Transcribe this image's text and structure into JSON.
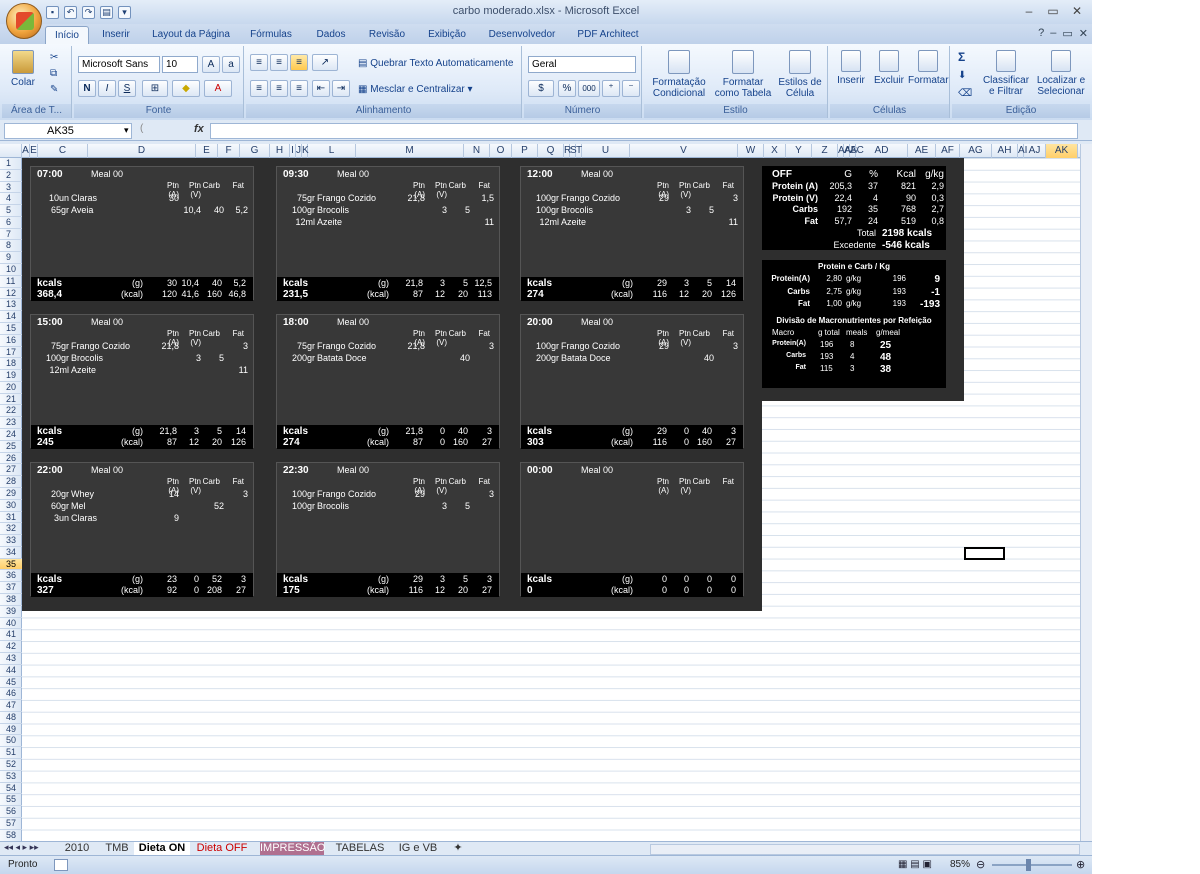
{
  "window": {
    "title": "carbo moderado.xlsx - Microsoft Excel"
  },
  "qat": [
    "save",
    "undo",
    "redo"
  ],
  "tabs": [
    "Início",
    "Inserir",
    "Layout da Página",
    "Fórmulas",
    "Dados",
    "Revisão",
    "Exibição",
    "Desenvolvedor",
    "PDF Architect"
  ],
  "ribbon": {
    "paste": "Colar",
    "area": "Área de T...",
    "font_name": "Microsoft Sans",
    "font_size": "10",
    "font_group": "Fonte",
    "bold": "N",
    "italic": "I",
    "underline": "S",
    "wrap": "Quebrar Texto Automaticamente",
    "merge": "Mesclar e Centralizar",
    "align_group": "Alinhamento",
    "numfmt": "Geral",
    "percent": "%",
    "thousands": "000",
    "num_group": "Número",
    "cond1": "Formatação",
    "cond2": "Condicional",
    "table1": "Formatar",
    "table2": "como Tabela",
    "styles1": "Estilos de",
    "styles2": "Célula",
    "style_group": "Estilo",
    "insert": "Inserir",
    "delete": "Excluir",
    "format": "Formatar",
    "cells_group": "Células",
    "sort1": "Classificar",
    "sort2": "e Filtrar",
    "find1": "Localizar e",
    "find2": "Selecionar",
    "edit_group": "Edição"
  },
  "formula": {
    "namebox": "AK35",
    "fx": "fx",
    "value": ""
  },
  "columns": [
    "A",
    "E",
    "C",
    "D",
    "E",
    "F",
    "G",
    "H",
    "I",
    "J",
    "K",
    "L",
    "M",
    "N",
    "O",
    "P",
    "Q",
    "R",
    "S",
    "T",
    "U",
    "V",
    "W",
    "X",
    "Y",
    "Z",
    "AA",
    "AB",
    "AC",
    "AD",
    "AE",
    "AF",
    "AG",
    "AH",
    "AI",
    "AJ",
    "AK",
    "AL",
    "AM"
  ],
  "meal_headers": [
    "Ptn (A)",
    "Ptn (V)",
    "Carb",
    "Fat"
  ],
  "meal_label": "Meal 00",
  "kcals_label": "kcals",
  "g_label": "(g)",
  "kcal_label": "(kcal)",
  "meals": [
    {
      "time": "07:00",
      "items": [
        {
          "q": "10un",
          "f": "Claras",
          "pa": "30",
          "pv": "",
          "c": "",
          "fat": ""
        },
        {
          "q": "65gr",
          "f": "Aveia",
          "pa": "",
          "pv": "10,4",
          "c": "40",
          "fat": "5,2"
        }
      ],
      "kcal": "368,4",
      "g": [
        "30",
        "10,4",
        "40",
        "5,2"
      ],
      "k": [
        "120",
        "41,6",
        "160",
        "46,8"
      ]
    },
    {
      "time": "09:30",
      "items": [
        {
          "q": "75gr",
          "f": "Frango Cozido",
          "pa": "21,8",
          "pv": "",
          "c": "",
          "fat": "1,5"
        },
        {
          "q": "100gr",
          "f": "Brocolis",
          "pa": "",
          "pv": "3",
          "c": "5",
          "fat": ""
        },
        {
          "q": "12ml",
          "f": "Azeite",
          "pa": "",
          "pv": "",
          "c": "",
          "fat": "11"
        }
      ],
      "kcal": "231,5",
      "g": [
        "21,8",
        "3",
        "5",
        "12,5"
      ],
      "k": [
        "87",
        "12",
        "20",
        "113"
      ]
    },
    {
      "time": "12:00",
      "items": [
        {
          "q": "100gr",
          "f": "Frango Cozido",
          "pa": "29",
          "pv": "",
          "c": "",
          "fat": "3"
        },
        {
          "q": "100gr",
          "f": "Brocolis",
          "pa": "",
          "pv": "3",
          "c": "5",
          "fat": ""
        },
        {
          "q": "12ml",
          "f": "Azeite",
          "pa": "",
          "pv": "",
          "c": "",
          "fat": "11"
        }
      ],
      "kcal": "274",
      "g": [
        "29",
        "3",
        "5",
        "14"
      ],
      "k": [
        "116",
        "12",
        "20",
        "126"
      ]
    },
    {
      "time": "15:00",
      "items": [
        {
          "q": "75gr",
          "f": "Frango Cozido",
          "pa": "21,8",
          "pv": "",
          "c": "",
          "fat": "3"
        },
        {
          "q": "100gr",
          "f": "Brocolis",
          "pa": "",
          "pv": "3",
          "c": "5",
          "fat": ""
        },
        {
          "q": "12ml",
          "f": "Azeite",
          "pa": "",
          "pv": "",
          "c": "",
          "fat": "11"
        }
      ],
      "kcal": "245",
      "g": [
        "21,8",
        "3",
        "5",
        "14"
      ],
      "k": [
        "87",
        "12",
        "20",
        "126"
      ]
    },
    {
      "time": "18:00",
      "items": [
        {
          "q": "75gr",
          "f": "Frango Cozido",
          "pa": "21,8",
          "pv": "",
          "c": "",
          "fat": "3"
        },
        {
          "q": "200gr",
          "f": "Batata Doce",
          "pa": "",
          "pv": "",
          "c": "40",
          "fat": ""
        }
      ],
      "kcal": "274",
      "g": [
        "21,8",
        "0",
        "40",
        "3"
      ],
      "k": [
        "87",
        "0",
        "160",
        "27"
      ]
    },
    {
      "time": "20:00",
      "items": [
        {
          "q": "100gr",
          "f": "Frango Cozido",
          "pa": "29",
          "pv": "",
          "c": "",
          "fat": "3"
        },
        {
          "q": "200gr",
          "f": "Batata Doce",
          "pa": "",
          "pv": "",
          "c": "40",
          "fat": ""
        }
      ],
      "kcal": "303",
      "g": [
        "29",
        "0",
        "40",
        "3"
      ],
      "k": [
        "116",
        "0",
        "160",
        "27"
      ]
    },
    {
      "time": "22:00",
      "items": [
        {
          "q": "20gr",
          "f": "Whey",
          "pa": "14",
          "pv": "",
          "c": "",
          "fat": "3"
        },
        {
          "q": "60gr",
          "f": "Mel",
          "pa": "",
          "pv": "",
          "c": "52",
          "fat": ""
        },
        {
          "q": "3un",
          "f": "Claras",
          "pa": "9",
          "pv": "",
          "c": "",
          "fat": ""
        }
      ],
      "kcal": "327",
      "g": [
        "23",
        "0",
        "52",
        "3"
      ],
      "k": [
        "92",
        "0",
        "208",
        "27"
      ]
    },
    {
      "time": "22:30",
      "items": [
        {
          "q": "100gr",
          "f": "Frango Cozido",
          "pa": "29",
          "pv": "",
          "c": "",
          "fat": "3"
        },
        {
          "q": "100gr",
          "f": "Brocolis",
          "pa": "",
          "pv": "3",
          "c": "5",
          "fat": ""
        }
      ],
      "kcal": "175",
      "g": [
        "29",
        "3",
        "5",
        "3"
      ],
      "k": [
        "116",
        "12",
        "20",
        "27"
      ]
    },
    {
      "time": "00:00",
      "items": [],
      "kcal": "0",
      "g": [
        "0",
        "0",
        "0",
        "0"
      ],
      "k": [
        "0",
        "0",
        "0",
        "0"
      ]
    }
  ],
  "off": {
    "title": "OFF",
    "cols": [
      "G",
      "%",
      "Kcal",
      "g/kg"
    ],
    "rows": [
      [
        "Protein (A)",
        "205,3",
        "37",
        "821",
        "2,9"
      ],
      [
        "Protein (V)",
        "22,4",
        "4",
        "90",
        "0,3"
      ],
      [
        "Carbs",
        "192",
        "35",
        "768",
        "2,7"
      ],
      [
        "Fat",
        "57,7",
        "24",
        "519",
        "0,8"
      ]
    ],
    "total_label": "Total",
    "total": "2198 kcals",
    "exc_label": "Excedente",
    "exc": "-546 kcals"
  },
  "pck": {
    "title": "Protein e Carb / Kg",
    "rows": [
      [
        "Protein(A)",
        "2,80",
        "g/kg",
        "196",
        "9"
      ],
      [
        "Carbs",
        "2,75",
        "g/kg",
        "193",
        "-1"
      ],
      [
        "Fat",
        "1,00",
        "g/kg",
        "193",
        "-193"
      ]
    ]
  },
  "div": {
    "title": "Divisão de Macronutrientes por Refeição",
    "cols": [
      "Macro",
      "g total",
      "meals",
      "g/meal"
    ],
    "rows": [
      [
        "Protein(A)",
        "196",
        "8",
        "25"
      ],
      [
        "Carbs",
        "193",
        "4",
        "48"
      ],
      [
        "Fat",
        "115",
        "3",
        "38"
      ]
    ]
  },
  "sheets": [
    "2010",
    "TMB",
    "Dieta ON",
    "Dieta OFF",
    "IMPRESSÃO",
    "TABELAS",
    "IG e VB"
  ],
  "status": {
    "ready": "Pronto",
    "zoom": "85%"
  }
}
